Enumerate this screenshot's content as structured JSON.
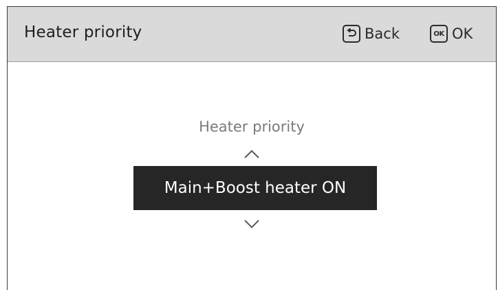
{
  "header": {
    "title": "Heater priority",
    "back_label": "Back",
    "ok_label": "OK",
    "ok_icon_text": "OK"
  },
  "selector": {
    "label": "Heater priority",
    "value": "Main+Boost heater ON"
  },
  "colors": {
    "header_bg": "#dadada",
    "value_bg": "#262626",
    "value_text": "#ffffff",
    "label_text": "#7a7a7a"
  }
}
